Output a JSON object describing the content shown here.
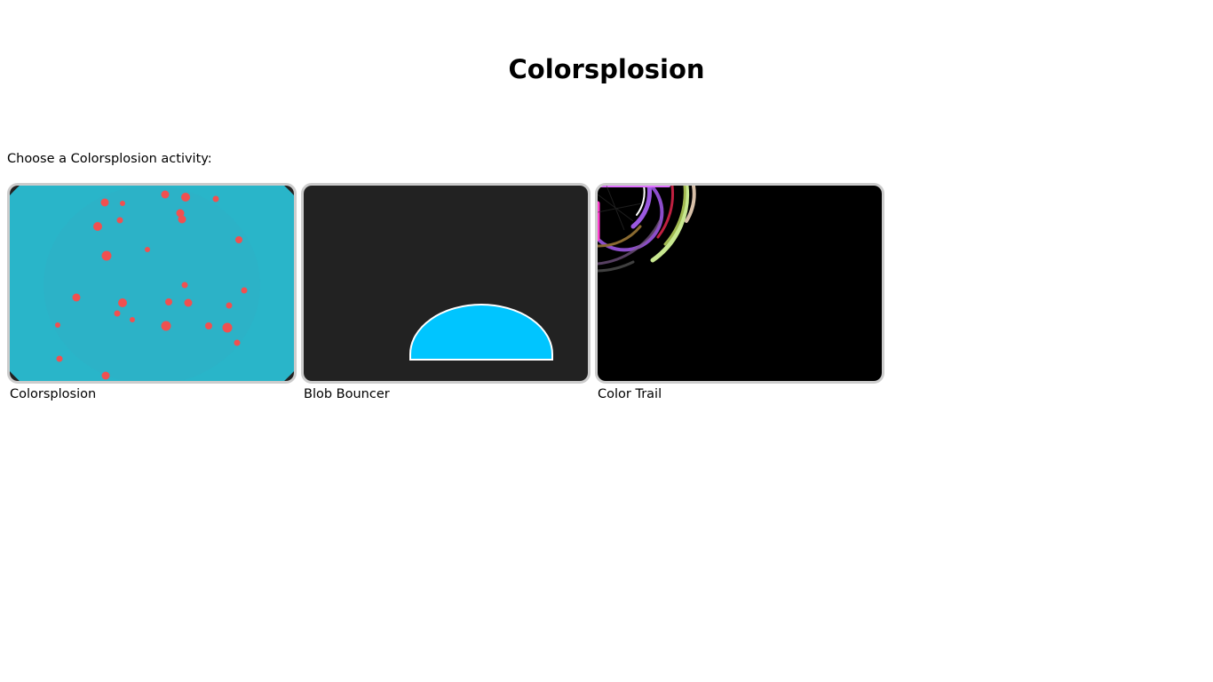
{
  "page": {
    "title": "Colorsplosion",
    "prompt": "Choose a Colorsplosion activity:"
  },
  "activities": [
    {
      "label": "Colorsplosion",
      "thumbnail": {
        "background": "#29b5c9",
        "corner_color": "#222222",
        "dot_color": "#f05050"
      }
    },
    {
      "label": "Blob Bouncer",
      "thumbnail": {
        "background": "#222222",
        "blob_color": "#00c5ff",
        "outline_color": "#ffffff"
      }
    },
    {
      "label": "Color Trail",
      "thumbnail": {
        "background": "#000000"
      }
    }
  ]
}
